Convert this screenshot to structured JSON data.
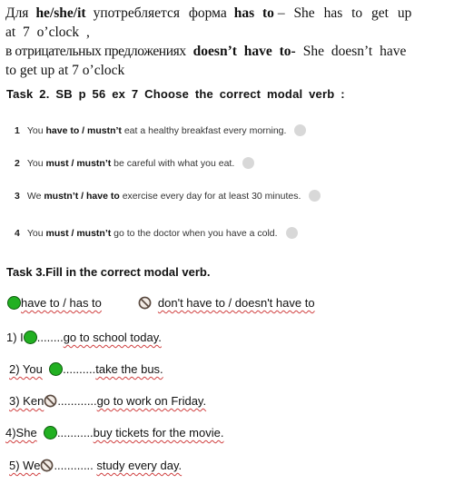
{
  "intro": {
    "line1": {
      "a": "Для",
      "b": "he/she/it",
      "c": "употребляется форма",
      "d": "has to",
      "e": "– She has to get up"
    },
    "line2": "at 7 o’clock ,",
    "line3": {
      "a": "в отрицательных предложениях",
      "b": "doesn’t have to-",
      "c": "She doesn’t have"
    },
    "line4": "to get up at 7 o’clock"
  },
  "task2": {
    "title": "Task 2. SB p 56 ex 7 Choose the correct modal verb :",
    "items": [
      {
        "num": "1",
        "pre": "You",
        "choice": "have to / mustn’t",
        "post": "eat a healthy breakfast every morning."
      },
      {
        "num": "2",
        "pre": "You",
        "choice": "must / mustn’t",
        "post": "be careful with what you eat."
      },
      {
        "num": "3",
        "pre": "We",
        "choice": "mustn’t / have to",
        "post": "exercise every day for at least 30 minutes."
      },
      {
        "num": "4",
        "pre": "You",
        "choice": "must / mustn’t",
        "post": "go to the doctor when you have a cold."
      }
    ]
  },
  "task3": {
    "title": "Task 3.Fill in the correct modal verb.",
    "legend": {
      "positive_icon": "green-circle-icon",
      "positive": "have to / has to",
      "negative_icon": "prohibited-icon",
      "negative": "don't have to / doesn't have to"
    },
    "items": [
      {
        "prefix": "1) I",
        "icon": "green-circle-icon",
        "blank": "........",
        "rest": "go to school today."
      },
      {
        "prefix": "2) You",
        "icon": "green-circle-icon",
        "blank": "..........",
        "rest": "take the bus."
      },
      {
        "prefix": "3) Ken",
        "icon": "prohibited-icon",
        "blank": "............",
        "rest": "go to work on Friday."
      },
      {
        "prefix": "4)She",
        "icon": "green-circle-icon",
        "blank": "...........",
        "rest": "buy tickets for the movie."
      },
      {
        "prefix": "5) We",
        "icon": "prohibited-icon",
        "blank": "............",
        "rest": " study every day."
      }
    ]
  },
  "colors": {
    "green": "#22b022",
    "prohibited": "#5a4a40",
    "grey_dot": "#d8d8d8"
  }
}
